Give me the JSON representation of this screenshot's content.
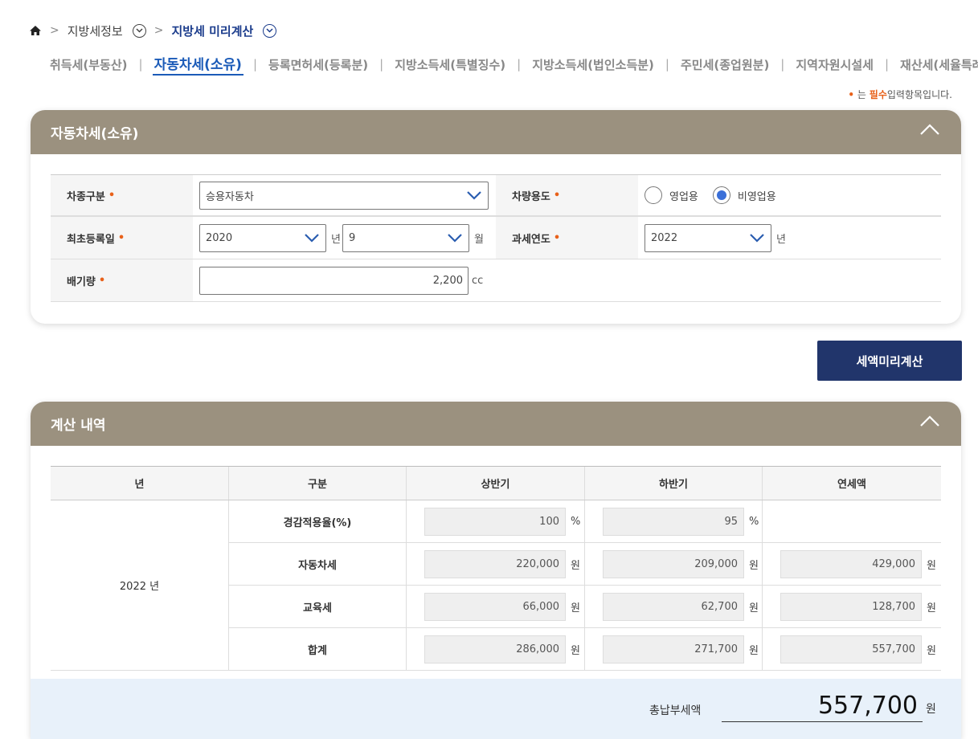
{
  "breadcrumb": {
    "level1": "지방세정보",
    "level2": "지방세 미리계산"
  },
  "tabs": [
    {
      "label": "취득세(부동산)",
      "active": false
    },
    {
      "label": "자동차세(소유)",
      "active": true
    },
    {
      "label": "등록면허세(등록분)",
      "active": false
    },
    {
      "label": "지방소득세(특별징수)",
      "active": false
    },
    {
      "label": "지방소득세(법인소득분)",
      "active": false
    },
    {
      "label": "주민세(종업원분)",
      "active": false
    },
    {
      "label": "지역자원시설세",
      "active": false
    },
    {
      "label": "재산세(세율특례)",
      "active": false
    }
  ],
  "required_note": {
    "dot": "•",
    "prefix": "는",
    "required": "필수",
    "suffix": "입력항목입니다."
  },
  "form_panel": {
    "title": "자동차세(소유)",
    "required_dot": "•",
    "vehicle_type": {
      "label": "차종구분",
      "value": "승용자동차"
    },
    "vehicle_use": {
      "label": "차량용도",
      "options": [
        {
          "label": "영업용",
          "selected": false
        },
        {
          "label": "비영업용",
          "selected": true
        }
      ]
    },
    "first_registration": {
      "label": "최초등록일",
      "year": "2020",
      "year_unit": "년",
      "month": "9",
      "month_unit": "월"
    },
    "tax_year": {
      "label": "과세연도",
      "value": "2022",
      "unit": "년"
    },
    "displacement": {
      "label": "배기량",
      "value": "2,200",
      "unit": "cc"
    }
  },
  "calc_button": {
    "label": "세액미리계산"
  },
  "result_panel": {
    "title": "계산 내역",
    "headers": [
      "년",
      "구분",
      "상반기",
      "하반기",
      "연세액"
    ],
    "year": "2022 년",
    "rows": [
      {
        "label": "경감적용율(%)",
        "first": "100",
        "first_unit": "%",
        "second": "95",
        "second_unit": "%",
        "annual": "",
        "annual_unit": ""
      },
      {
        "label": "자동차세",
        "first": "220,000",
        "first_unit": "원",
        "second": "209,000",
        "second_unit": "원",
        "annual": "429,000",
        "annual_unit": "원"
      },
      {
        "label": "교육세",
        "first": "66,000",
        "first_unit": "원",
        "second": "62,700",
        "second_unit": "원",
        "annual": "128,700",
        "annual_unit": "원"
      },
      {
        "label": "합계",
        "first": "286,000",
        "first_unit": "원",
        "second": "271,700",
        "second_unit": "원",
        "annual": "557,700",
        "annual_unit": "원"
      }
    ],
    "total": {
      "label": "총납부세액",
      "value": "557,700",
      "unit": "원"
    }
  },
  "colors": {
    "panel_header": "#9b917f",
    "button": "#21356b",
    "accent": "#1b5bb8",
    "required": "#e8611a",
    "total_bg": "#e8f1fa"
  }
}
